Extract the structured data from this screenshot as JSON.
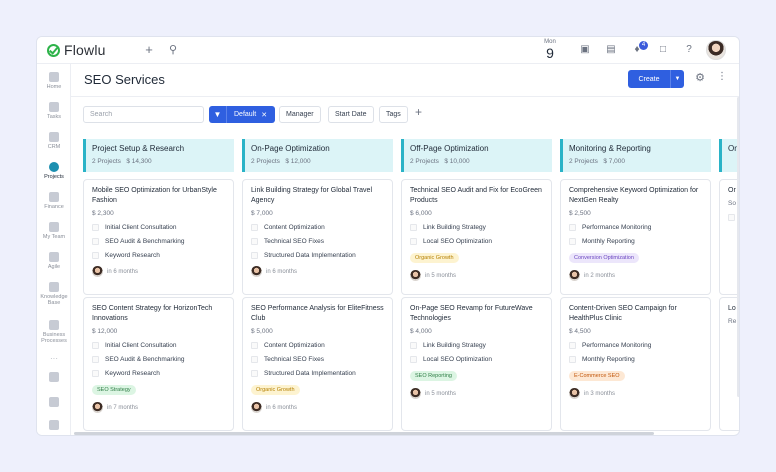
{
  "app": {
    "name": "Flowlu"
  },
  "topbar": {
    "date_month": "Mon",
    "date_day": "9",
    "notification_count": "4",
    "icons": [
      "plus-icon",
      "search-icon",
      "calendar-icon",
      "invoice-icon",
      "bell-icon",
      "chat-icon",
      "help-icon"
    ]
  },
  "sidebar": {
    "items": [
      {
        "label": "Home",
        "icon": "home-icon"
      },
      {
        "label": "Tasks",
        "icon": "tasks-icon"
      },
      {
        "label": "CRM",
        "icon": "crm-icon"
      },
      {
        "label": "Projects",
        "icon": "projects-icon",
        "active": true
      },
      {
        "label": "Finance",
        "icon": "finance-icon"
      },
      {
        "label": "My Team",
        "icon": "team-icon"
      },
      {
        "label": "Agile",
        "icon": "agile-icon"
      },
      {
        "label": "Knowledge Base",
        "icon": "knowledge-base-icon"
      },
      {
        "label": "Business Processes",
        "icon": "business-processes-icon"
      }
    ]
  },
  "page": {
    "title": "SEO Services",
    "create_label": "Create"
  },
  "filters": {
    "search_placeholder": "Search",
    "default_label": "Default",
    "manager_label": "Manager",
    "start_date_label": "Start Date",
    "tags_label": "Tags"
  },
  "colors": {
    "accent": "#2f5fe0",
    "column_header_bg": "#dcf4f7",
    "column_header_border": "#2ab3c7",
    "tag_seo_strategy": "#dcf5e3",
    "tag_organic_growth": "#fdf3d0",
    "tag_conversion_optimization": "#ece6fb",
    "tag_seo_reporting": "#dcf5e3",
    "tag_ecommerce_seo": "#fde8d4"
  },
  "columns": [
    {
      "title": "Project Setup & Research",
      "projects": "2 Projects",
      "amount": "$ 14,300",
      "cards": [
        {
          "title": "Mobile SEO Optimization for UrbanStyle Fashion",
          "price": "$ 2,300",
          "tasks": [
            "Initial Client Consultation",
            "SEO Audit & Benchmarking",
            "Keyword Research"
          ],
          "tag": "",
          "due": "in 6 months"
        },
        {
          "title": "SEO Content Strategy for HorizonTech Innovations",
          "price": "$ 12,000",
          "tasks": [
            "Initial Client Consultation",
            "SEO Audit & Benchmarking",
            "Keyword Research"
          ],
          "tag": "SEO Strategy",
          "due": "in 7 months"
        }
      ]
    },
    {
      "title": "On-Page Optimization",
      "projects": "2 Projects",
      "amount": "$ 12,000",
      "cards": [
        {
          "title": "Link Building Strategy for Global Travel Agency",
          "price": "$ 7,000",
          "tasks": [
            "Content Optimization",
            "Technical SEO Fixes",
            "Structured Data Implementation"
          ],
          "tag": "",
          "due": "in 6 months"
        },
        {
          "title": "SEO Performance Analysis for EliteFitness Club",
          "price": "$ 5,000",
          "tasks": [
            "Content Optimization",
            "Technical SEO Fixes",
            "Structured Data Implementation"
          ],
          "tag": "Organic Growth",
          "due": "in 6 months"
        }
      ]
    },
    {
      "title": "Off-Page Optimization",
      "projects": "2 Projects",
      "amount": "$ 10,000",
      "cards": [
        {
          "title": "Technical SEO Audit and Fix for EcoGreen Products",
          "price": "$ 6,000",
          "tasks": [
            "Link Building Strategy",
            "Local SEO Optimization"
          ],
          "tag": "Organic Growth",
          "due": "in 5 months"
        },
        {
          "title": "On-Page SEO Revamp for FutureWave Technologies",
          "price": "$ 4,000",
          "tasks": [
            "Link Building Strategy",
            "Local SEO Optimization"
          ],
          "tag": "SEO Reporting",
          "due": "in 5 months"
        }
      ]
    },
    {
      "title": "Monitoring & Reporting",
      "projects": "2 Projects",
      "amount": "$ 7,000",
      "cards": [
        {
          "title": "Comprehensive Keyword Optimization for NextGen Realty",
          "price": "$ 2,500",
          "tasks": [
            "Performance Monitoring",
            "Monthly Reporting"
          ],
          "tag": "Conversion Optimization",
          "due": "in 2 months"
        },
        {
          "title": "Content-Driven SEO Campaign for HealthPlus Clinic",
          "price": "$ 4,500",
          "tasks": [
            "Performance Monitoring",
            "Monthly Reporting"
          ],
          "tag": "E-Commerce SEO",
          "due": "in 3 months"
        }
      ]
    },
    {
      "title": "On",
      "projects": "",
      "amount": "",
      "cards": [
        {
          "title": "Or",
          "price": "So",
          "tasks": [
            "Fi"
          ],
          "tag": "",
          "due": ""
        },
        {
          "title": "Lo",
          "price": "Re",
          "tasks": [],
          "tag": "",
          "due": ""
        }
      ]
    }
  ]
}
